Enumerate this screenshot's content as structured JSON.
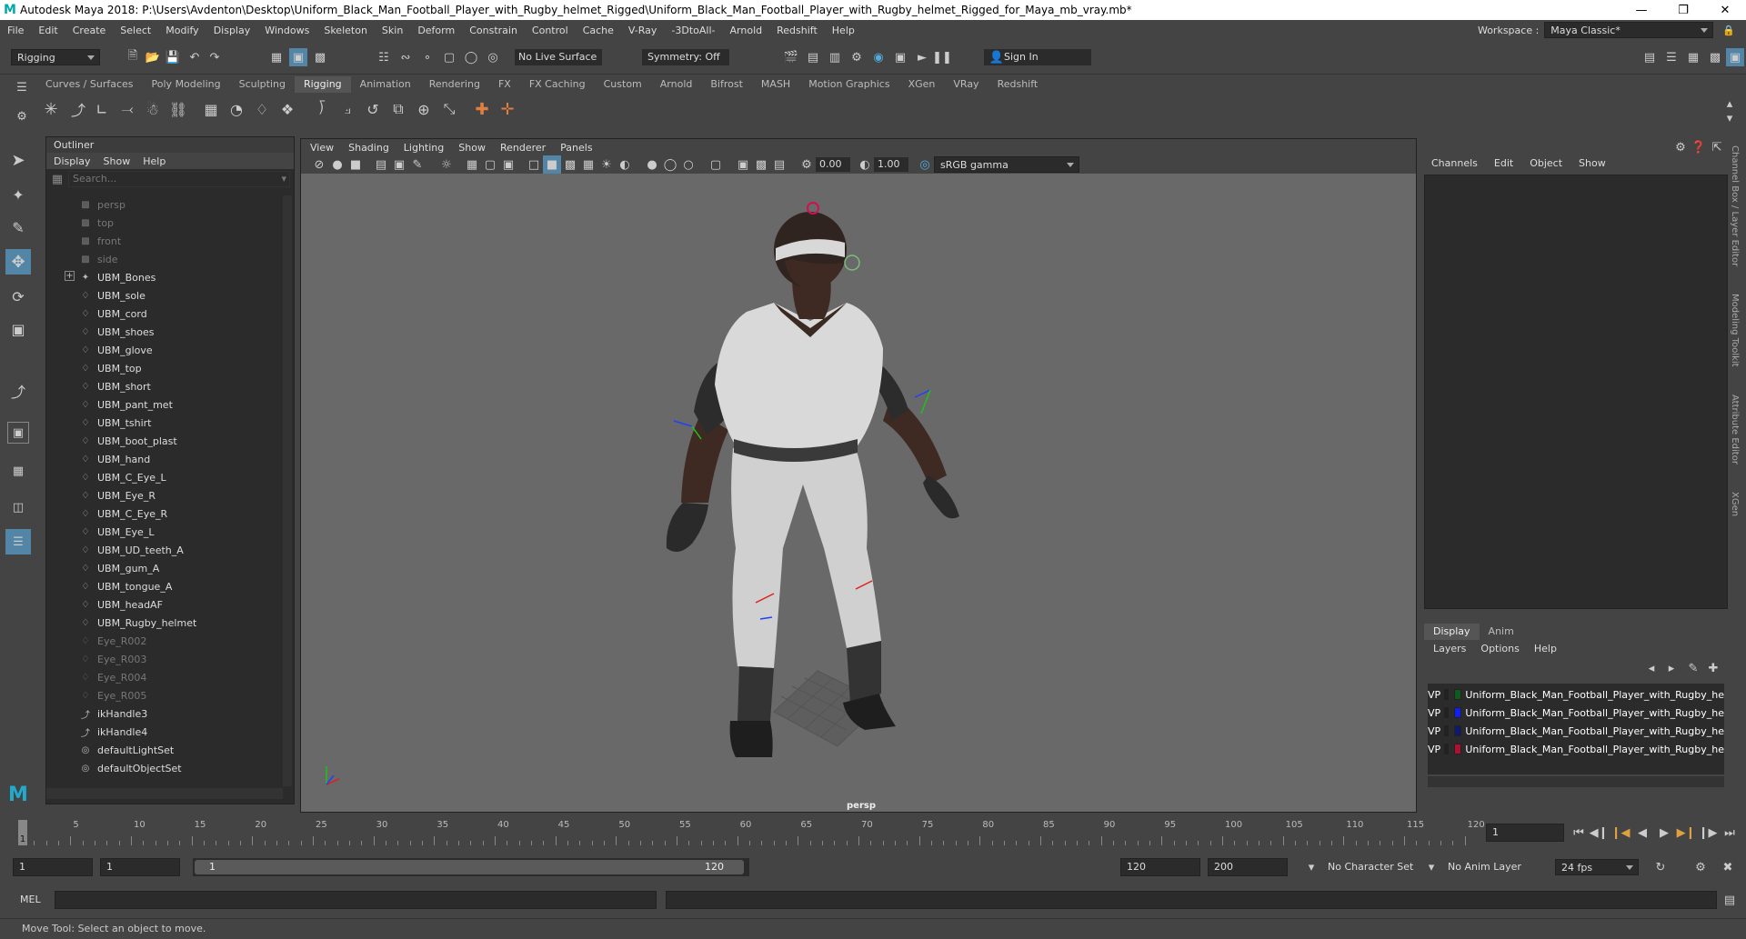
{
  "title_bar": {
    "title": "Autodesk Maya 2018: P:\\Users\\Avdenton\\Desktop\\Uniform_Black_Man_Football_Player_with_Rugby_helmet_Rigged\\Uniform_Black_Man_Football_Player_with_Rugby_helmet_Rigged_for_Maya_mb_vray.mb*",
    "logo": "M"
  },
  "menubar": {
    "items": [
      "File",
      "Edit",
      "Create",
      "Select",
      "Modify",
      "Display",
      "Windows",
      "Skeleton",
      "Skin",
      "Deform",
      "Constrain",
      "Control",
      "Cache",
      "V-Ray",
      "-3DtoAll-",
      "Arnold",
      "Redshift",
      "Help"
    ],
    "workspace_label": "Workspace :",
    "workspace_value": "Maya Classic*"
  },
  "status_line": {
    "mode": "Rigging",
    "live_surface": "No Live Surface",
    "symmetry": "Symmetry: Off",
    "sign_in": "Sign In"
  },
  "shelf_tabs": [
    "Curves / Surfaces",
    "Poly Modeling",
    "Sculpting",
    "Rigging",
    "Animation",
    "Rendering",
    "FX",
    "FX Caching",
    "Custom",
    "Arnold",
    "Bifrost",
    "MASH",
    "Motion Graphics",
    "XGen",
    "VRay",
    "Redshift"
  ],
  "shelf_active": "Rigging",
  "outliner": {
    "title": "Outliner",
    "menu": [
      "Display",
      "Show",
      "Help"
    ],
    "search_placeholder": "Search...",
    "items": [
      {
        "label": "persp",
        "icon": "camera-icon",
        "dim": true
      },
      {
        "label": "top",
        "icon": "camera-icon",
        "dim": true
      },
      {
        "label": "front",
        "icon": "camera-icon",
        "dim": true
      },
      {
        "label": "side",
        "icon": "camera-icon",
        "dim": true
      },
      {
        "label": "UBM_Bones",
        "icon": "joint-icon",
        "dim": false,
        "expand": true
      },
      {
        "label": "UBM_sole",
        "icon": "mesh-icon",
        "dim": false
      },
      {
        "label": "UBM_cord",
        "icon": "mesh-icon",
        "dim": false
      },
      {
        "label": "UBM_shoes",
        "icon": "mesh-icon",
        "dim": false
      },
      {
        "label": "UBM_glove",
        "icon": "mesh-icon",
        "dim": false
      },
      {
        "label": "UBM_top",
        "icon": "mesh-icon",
        "dim": false
      },
      {
        "label": "UBM_short",
        "icon": "mesh-icon",
        "dim": false
      },
      {
        "label": "UBM_pant_met",
        "icon": "mesh-icon",
        "dim": false
      },
      {
        "label": "UBM_tshirt",
        "icon": "mesh-icon",
        "dim": false
      },
      {
        "label": "UBM_boot_plast",
        "icon": "mesh-icon",
        "dim": false
      },
      {
        "label": "UBM_hand",
        "icon": "mesh-icon",
        "dim": false
      },
      {
        "label": "UBM_C_Eye_L",
        "icon": "mesh-icon",
        "dim": false
      },
      {
        "label": "UBM_Eye_R",
        "icon": "mesh-icon",
        "dim": false
      },
      {
        "label": "UBM_C_Eye_R",
        "icon": "mesh-icon",
        "dim": false
      },
      {
        "label": "UBM_Eye_L",
        "icon": "mesh-icon",
        "dim": false
      },
      {
        "label": "UBM_UD_teeth_A",
        "icon": "mesh-icon",
        "dim": false
      },
      {
        "label": "UBM_gum_A",
        "icon": "mesh-icon",
        "dim": false
      },
      {
        "label": "UBM_tongue_A",
        "icon": "mesh-icon",
        "dim": false
      },
      {
        "label": "UBM_headAF",
        "icon": "mesh-icon",
        "dim": false
      },
      {
        "label": "UBM_Rugby_helmet",
        "icon": "mesh-icon",
        "dim": false
      },
      {
        "label": "Eye_R002",
        "icon": "mesh-icon",
        "dim": true
      },
      {
        "label": "Eye_R003",
        "icon": "mesh-icon",
        "dim": true
      },
      {
        "label": "Eye_R004",
        "icon": "mesh-icon",
        "dim": true
      },
      {
        "label": "Eye_R005",
        "icon": "mesh-icon",
        "dim": true
      },
      {
        "label": "ikHandle3",
        "icon": "ik-handle-icon",
        "dim": false
      },
      {
        "label": "ikHandle4",
        "icon": "ik-handle-icon",
        "dim": false
      },
      {
        "label": "defaultLightSet",
        "icon": "set-icon",
        "dim": false
      },
      {
        "label": "defaultObjectSet",
        "icon": "set-icon",
        "dim": false
      }
    ]
  },
  "viewport": {
    "menu": [
      "View",
      "Shading",
      "Lighting",
      "Show",
      "Renderer",
      "Panels"
    ],
    "near_value": "0.00",
    "far_value": "1.00",
    "color_space": "sRGB gamma",
    "camera_label": "persp"
  },
  "channel_box": {
    "menu": [
      "Channels",
      "Edit",
      "Object",
      "Show"
    ]
  },
  "layer_editor": {
    "tabs": [
      "Display",
      "Anim"
    ],
    "active_tab": "Display",
    "menu": [
      "Layers",
      "Options",
      "Help"
    ],
    "layers": [
      {
        "v": "V",
        "p": "P",
        "color": "#0f5a1e",
        "name": "Uniform_Black_Man_Football_Player_with_Rugby_he"
      },
      {
        "v": "V",
        "p": "P",
        "color": "#1020f0",
        "name": "Uniform_Black_Man_Football_Player_with_Rugby_he"
      },
      {
        "v": "V",
        "p": "P",
        "color": "#101a6a",
        "name": "Uniform_Black_Man_Football_Player_with_Rugby_he"
      },
      {
        "v": "V",
        "p": "P",
        "color": "#b01030",
        "name": "Uniform_Black_Man_Football_Player_with_Rugby_he"
      }
    ]
  },
  "side_tabs": [
    "Channel Box / Layer Editor",
    "Modeling Toolkit",
    "Attribute Editor",
    "XGen"
  ],
  "timeline": {
    "ticks": [
      "5",
      "10",
      "15",
      "20",
      "25",
      "30",
      "35",
      "40",
      "45",
      "50",
      "55",
      "60",
      "65",
      "70",
      "75",
      "80",
      "85",
      "90",
      "95",
      "100",
      "105",
      "110",
      "115",
      "120"
    ],
    "current_marker": "1",
    "current_frame": "1"
  },
  "range": {
    "start": "1",
    "playback_start": "1",
    "slider_start": "1",
    "slider_end": "120",
    "playback_end": "120",
    "end": "200",
    "character_set": "No Character Set",
    "anim_layer": "No Anim Layer",
    "fps": "24 fps"
  },
  "command_line": {
    "label": "MEL"
  },
  "help_line": {
    "text": "Move Tool: Select an object to move."
  }
}
